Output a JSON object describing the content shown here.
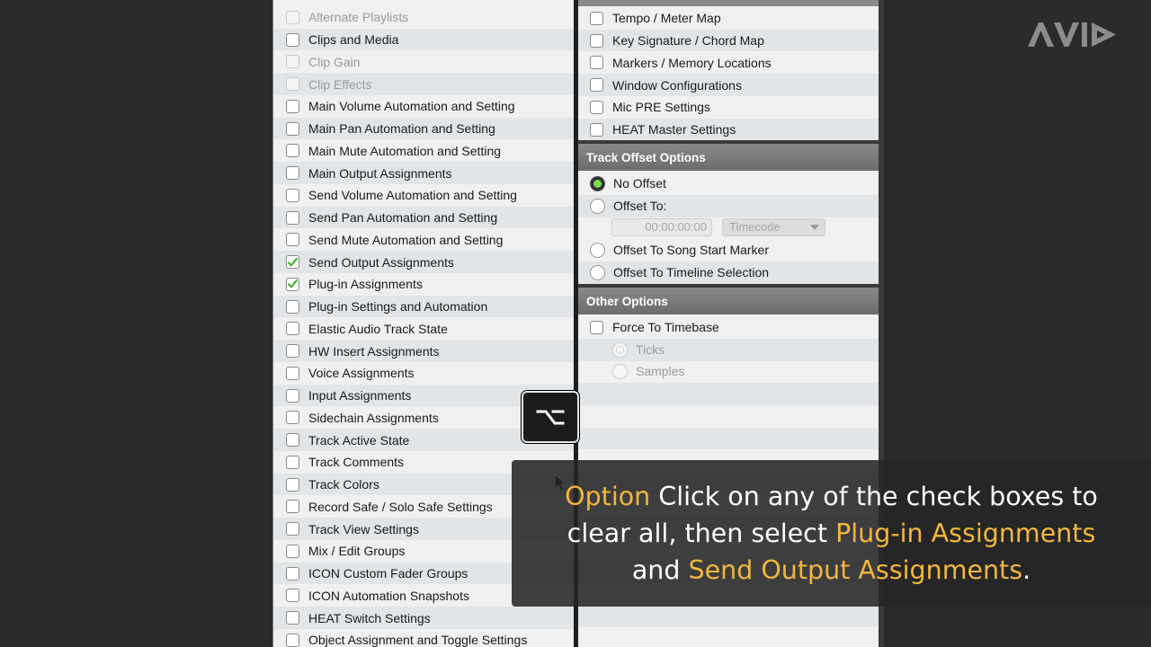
{
  "left_list": [
    {
      "label": "Alternate Playlists",
      "checked": false,
      "disabled": true
    },
    {
      "label": "Clips and Media",
      "checked": false,
      "disabled": false
    },
    {
      "label": "Clip Gain",
      "checked": false,
      "disabled": true
    },
    {
      "label": "Clip Effects",
      "checked": false,
      "disabled": true
    },
    {
      "label": "Main Volume Automation and Setting",
      "checked": false,
      "disabled": false
    },
    {
      "label": "Main Pan Automation and Setting",
      "checked": false,
      "disabled": false
    },
    {
      "label": "Main Mute Automation and Setting",
      "checked": false,
      "disabled": false
    },
    {
      "label": "Main Output Assignments",
      "checked": false,
      "disabled": false
    },
    {
      "label": "Send Volume Automation and Setting",
      "checked": false,
      "disabled": false
    },
    {
      "label": "Send Pan Automation and Setting",
      "checked": false,
      "disabled": false
    },
    {
      "label": "Send Mute Automation and Setting",
      "checked": false,
      "disabled": false
    },
    {
      "label": "Send Output Assignments",
      "checked": true,
      "disabled": false
    },
    {
      "label": "Plug-in Assignments",
      "checked": true,
      "disabled": false
    },
    {
      "label": "Plug-in Settings and Automation",
      "checked": false,
      "disabled": false
    },
    {
      "label": "Elastic Audio Track State",
      "checked": false,
      "disabled": false
    },
    {
      "label": "HW Insert Assignments",
      "checked": false,
      "disabled": false
    },
    {
      "label": "Voice Assignments",
      "checked": false,
      "disabled": false
    },
    {
      "label": "Input Assignments",
      "checked": false,
      "disabled": false
    },
    {
      "label": "Sidechain Assignments",
      "checked": false,
      "disabled": false
    },
    {
      "label": "Track Active State",
      "checked": false,
      "disabled": false
    },
    {
      "label": "Track Comments",
      "checked": false,
      "disabled": false
    },
    {
      "label": "Track Colors",
      "checked": false,
      "disabled": false
    },
    {
      "label": "Record Safe / Solo Safe Settings",
      "checked": false,
      "disabled": false
    },
    {
      "label": "Track View Settings",
      "checked": false,
      "disabled": false
    },
    {
      "label": "Mix / Edit Groups",
      "checked": false,
      "disabled": false
    },
    {
      "label": "ICON Custom Fader Groups",
      "checked": false,
      "disabled": false
    },
    {
      "label": "ICON Automation Snapshots",
      "checked": false,
      "disabled": false
    },
    {
      "label": "HEAT Switch Settings",
      "checked": false,
      "disabled": false
    },
    {
      "label": "Object Assignment and Toggle Settings",
      "checked": false,
      "disabled": false
    }
  ],
  "right_top_list": [
    {
      "label": "Tempo / Meter Map",
      "checked": false
    },
    {
      "label": "Key Signature / Chord Map",
      "checked": false
    },
    {
      "label": "Markers / Memory Locations",
      "checked": false
    },
    {
      "label": "Window Configurations",
      "checked": false
    },
    {
      "label": "Mic PRE Settings",
      "checked": false
    },
    {
      "label": "HEAT Master Settings",
      "checked": false
    }
  ],
  "track_offset": {
    "header": "Track Offset Options",
    "no_offset": "No Offset",
    "offset_to": "Offset To:",
    "timecode_value": "00:00:00:00",
    "timecode_format": "Timecode",
    "song_start": "Offset To Song Start Marker",
    "timeline_selection": "Offset To Timeline Selection",
    "selected": "No Offset"
  },
  "other_options": {
    "header": "Other Options",
    "force_timebase": "Force To Timebase",
    "force_timebase_checked": false,
    "ticks": "Ticks",
    "samples": "Samples"
  },
  "key_badge": {
    "symbol": "⌥"
  },
  "caption": {
    "p1_hl": "Option",
    "p1_text": " Click on any of the check boxes to",
    "p2_text": "clear all, then select ",
    "p2_hl": "Plug-in Assignments",
    "p3_text": "and ",
    "p3_hl": "Send Output Assignments",
    "p3_end": "."
  },
  "colors": {
    "highlight": "#f3b73b",
    "check": "#3fae2a",
    "radio_on": "#7be04a"
  },
  "logo": {
    "name": "avid-logo"
  }
}
